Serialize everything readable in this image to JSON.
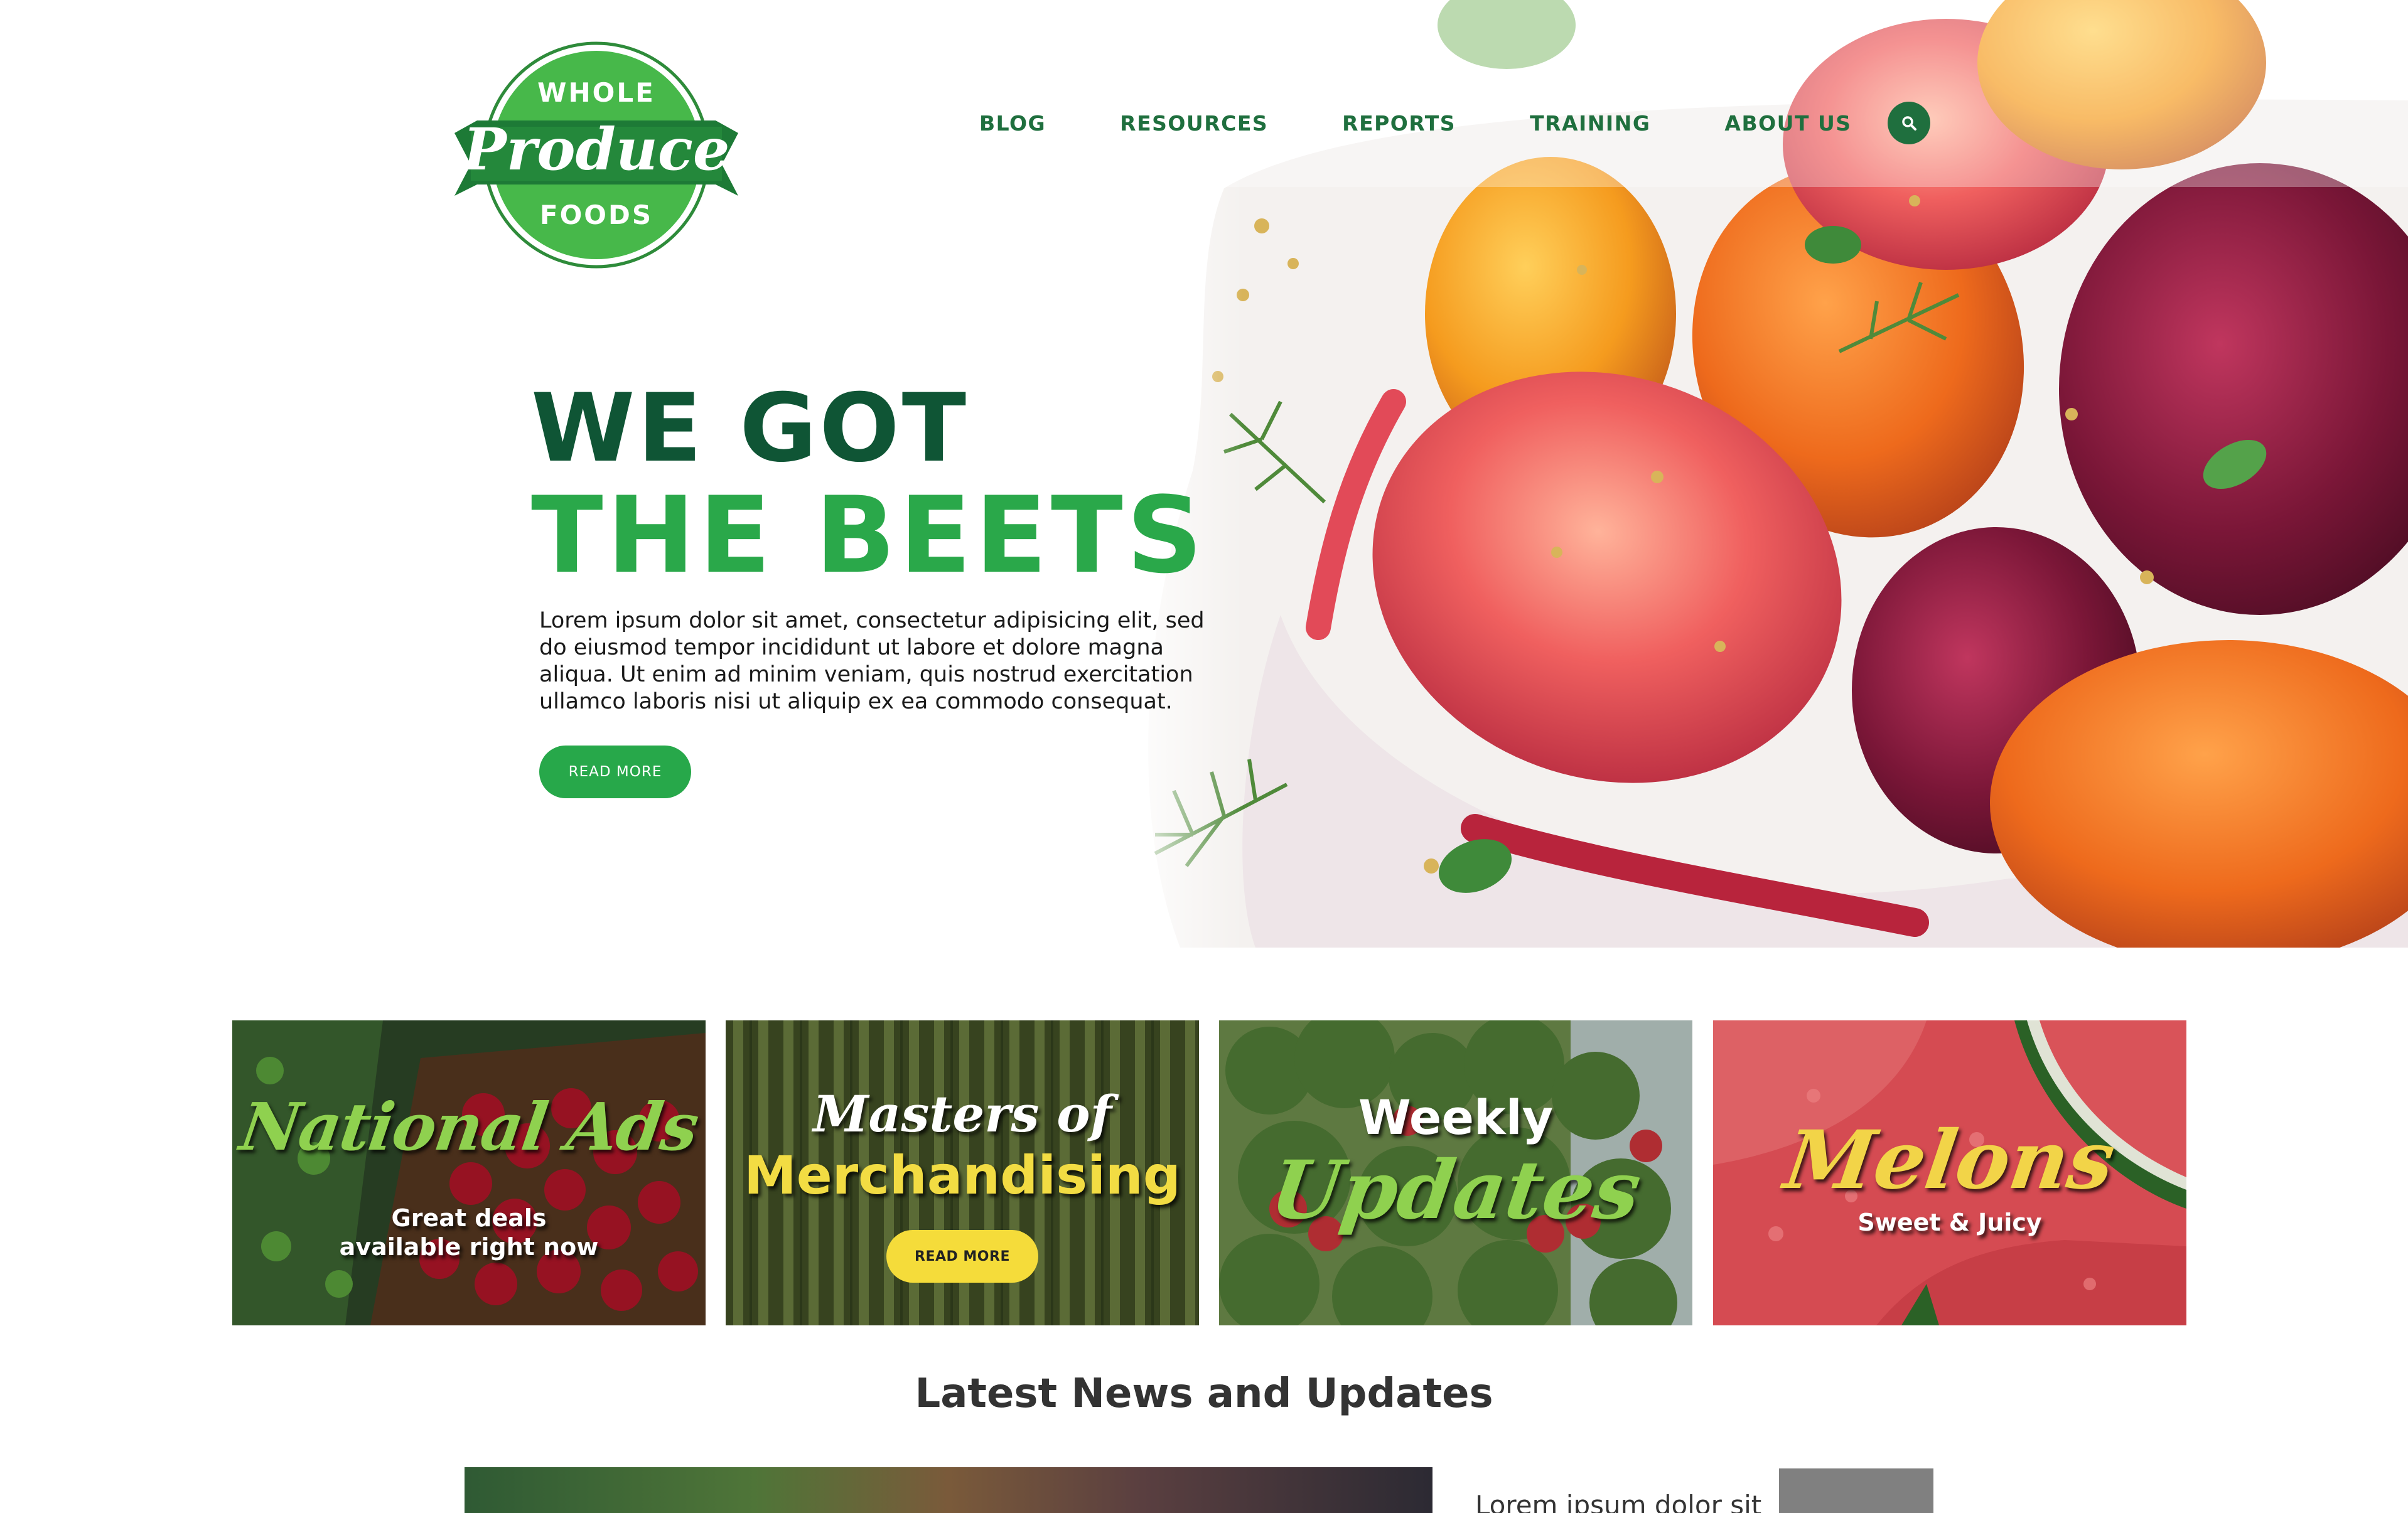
{
  "logo": {
    "top": "WHOLE",
    "middle": "Produce",
    "bottom": "FOODS"
  },
  "nav": {
    "items": [
      "BLOG",
      "RESOURCES",
      "REPORTS",
      "TRAINING",
      "ABOUT US"
    ],
    "search_icon": "search-icon"
  },
  "hero": {
    "heading_line1": "WE GOT",
    "heading_line2": "THE BEETS",
    "body": "Lorem ipsum dolor sit amet, consectetur adipisicing elit, sed do eiusmod tempor incididunt ut labore et dolore magna aliqua. Ut enim ad minim veniam, quis nostrud exercitation ullamco laboris nisi ut aliquip ex ea commodo consequat.",
    "cta": "READ MORE"
  },
  "cards": [
    {
      "title": "National Ads",
      "subtitle": "Great deals available right now"
    },
    {
      "title": "Masters of",
      "subtitle": "Merchandising",
      "cta": "READ MORE"
    },
    {
      "title": "Weekly",
      "subtitle": "Updates"
    },
    {
      "title": "Melons",
      "subtitle": "Sweet & Juicy"
    }
  ],
  "news": {
    "heading": "Latest News and Updates",
    "items": [
      {
        "title": "Lorem ipsum dolor sit"
      }
    ]
  },
  "colors": {
    "brand_dark_green": "#0f5535",
    "brand_green": "#2aa84a",
    "nav_green": "#1f6f3e",
    "accent_yellow": "#f5dc3a",
    "logo_green": "#47b84a"
  }
}
